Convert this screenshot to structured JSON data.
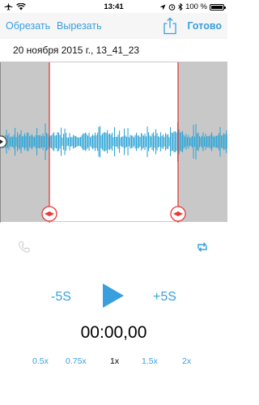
{
  "status_bar": {
    "time": "13:41",
    "battery": "100 %",
    "icons": [
      "airplane-icon",
      "wifi-icon",
      "location-icon",
      "alarm-icon",
      "bluetooth-icon",
      "battery-icon"
    ]
  },
  "toolbar": {
    "trim_label": "Обрезать",
    "cut_label": "Вырезать",
    "done_label": "Готово",
    "share_icon": "share-icon"
  },
  "recording": {
    "title": "20 ноября 2015 г., 13_41_23"
  },
  "editor": {
    "selection": {
      "start_fraction": 0.217,
      "end_fraction": 0.783
    },
    "playhead_fraction": 0.0
  },
  "controls": {
    "back_label": "-5S",
    "forward_label": "+5S",
    "play_icon": "play-icon",
    "phone_icon": "phone-icon",
    "repeat_icon": "repeat-icon",
    "timer": "00:00,00"
  },
  "speeds": {
    "options": [
      "0.5x",
      "0.75x",
      "1x",
      "1.5x",
      "2x"
    ],
    "selected": "1x"
  },
  "colors": {
    "accent": "#3a9fde",
    "waveform": "#34a6d6",
    "handle": "#e8393a",
    "shade": "#c8c8c8"
  }
}
